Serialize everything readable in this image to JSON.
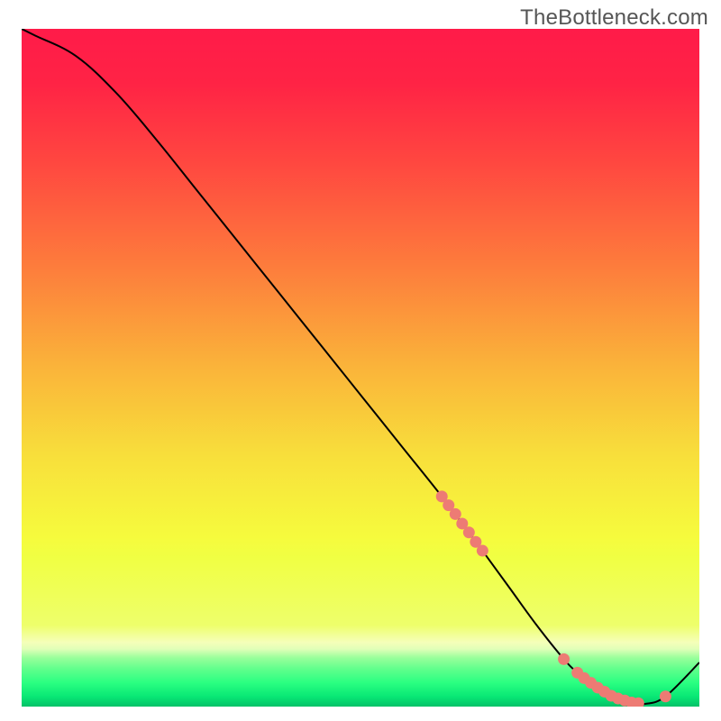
{
  "watermark": "TheBottleneck.com",
  "chart_data": {
    "type": "line",
    "x": [
      0,
      2,
      8,
      14,
      20,
      26,
      32,
      38,
      44,
      50,
      56,
      62,
      65,
      68,
      72,
      76,
      80,
      82,
      84,
      86,
      88,
      90,
      92,
      95,
      100
    ],
    "y": [
      100,
      99,
      96,
      90.5,
      83.5,
      76,
      68.5,
      61,
      53.5,
      46,
      38.5,
      31,
      27,
      23,
      17.5,
      12,
      7,
      5,
      3.5,
      2.2,
      1.2,
      0.6,
      0.4,
      1.5,
      6.5
    ],
    "xlim": [
      0,
      100
    ],
    "ylim": [
      0,
      100
    ],
    "marker_points_x": [
      62,
      63,
      64,
      65,
      66,
      67,
      68,
      80,
      82,
      83,
      84,
      85,
      86,
      87,
      88,
      89,
      90,
      91,
      95
    ],
    "marker_points_y": [
      31,
      29.7,
      28.4,
      27,
      25.7,
      24.3,
      23,
      7,
      5,
      4.2,
      3.5,
      2.8,
      2.2,
      1.6,
      1.2,
      0.9,
      0.6,
      0.5,
      1.5
    ],
    "marker_color": "#ed7b74",
    "line_color": "#000000",
    "gradient_stops": [
      {
        "offset": 0.0,
        "color": "#ff1b49"
      },
      {
        "offset": 0.08,
        "color": "#ff2345"
      },
      {
        "offset": 0.2,
        "color": "#ff4840"
      },
      {
        "offset": 0.35,
        "color": "#fd7c3c"
      },
      {
        "offset": 0.5,
        "color": "#fab43a"
      },
      {
        "offset": 0.63,
        "color": "#f8df3b"
      },
      {
        "offset": 0.75,
        "color": "#f6fb3d"
      },
      {
        "offset": 0.78,
        "color": "#f0ff43"
      },
      {
        "offset": 0.88,
        "color": "#eeff6b"
      },
      {
        "offset": 0.905,
        "color": "#f5ffb9"
      },
      {
        "offset": 0.915,
        "color": "#e1ffb8"
      },
      {
        "offset": 0.928,
        "color": "#99ff9b"
      },
      {
        "offset": 0.945,
        "color": "#5fff8c"
      },
      {
        "offset": 0.965,
        "color": "#2aff81"
      },
      {
        "offset": 0.985,
        "color": "#09e875"
      },
      {
        "offset": 1.0,
        "color": "#03c168"
      }
    ]
  }
}
